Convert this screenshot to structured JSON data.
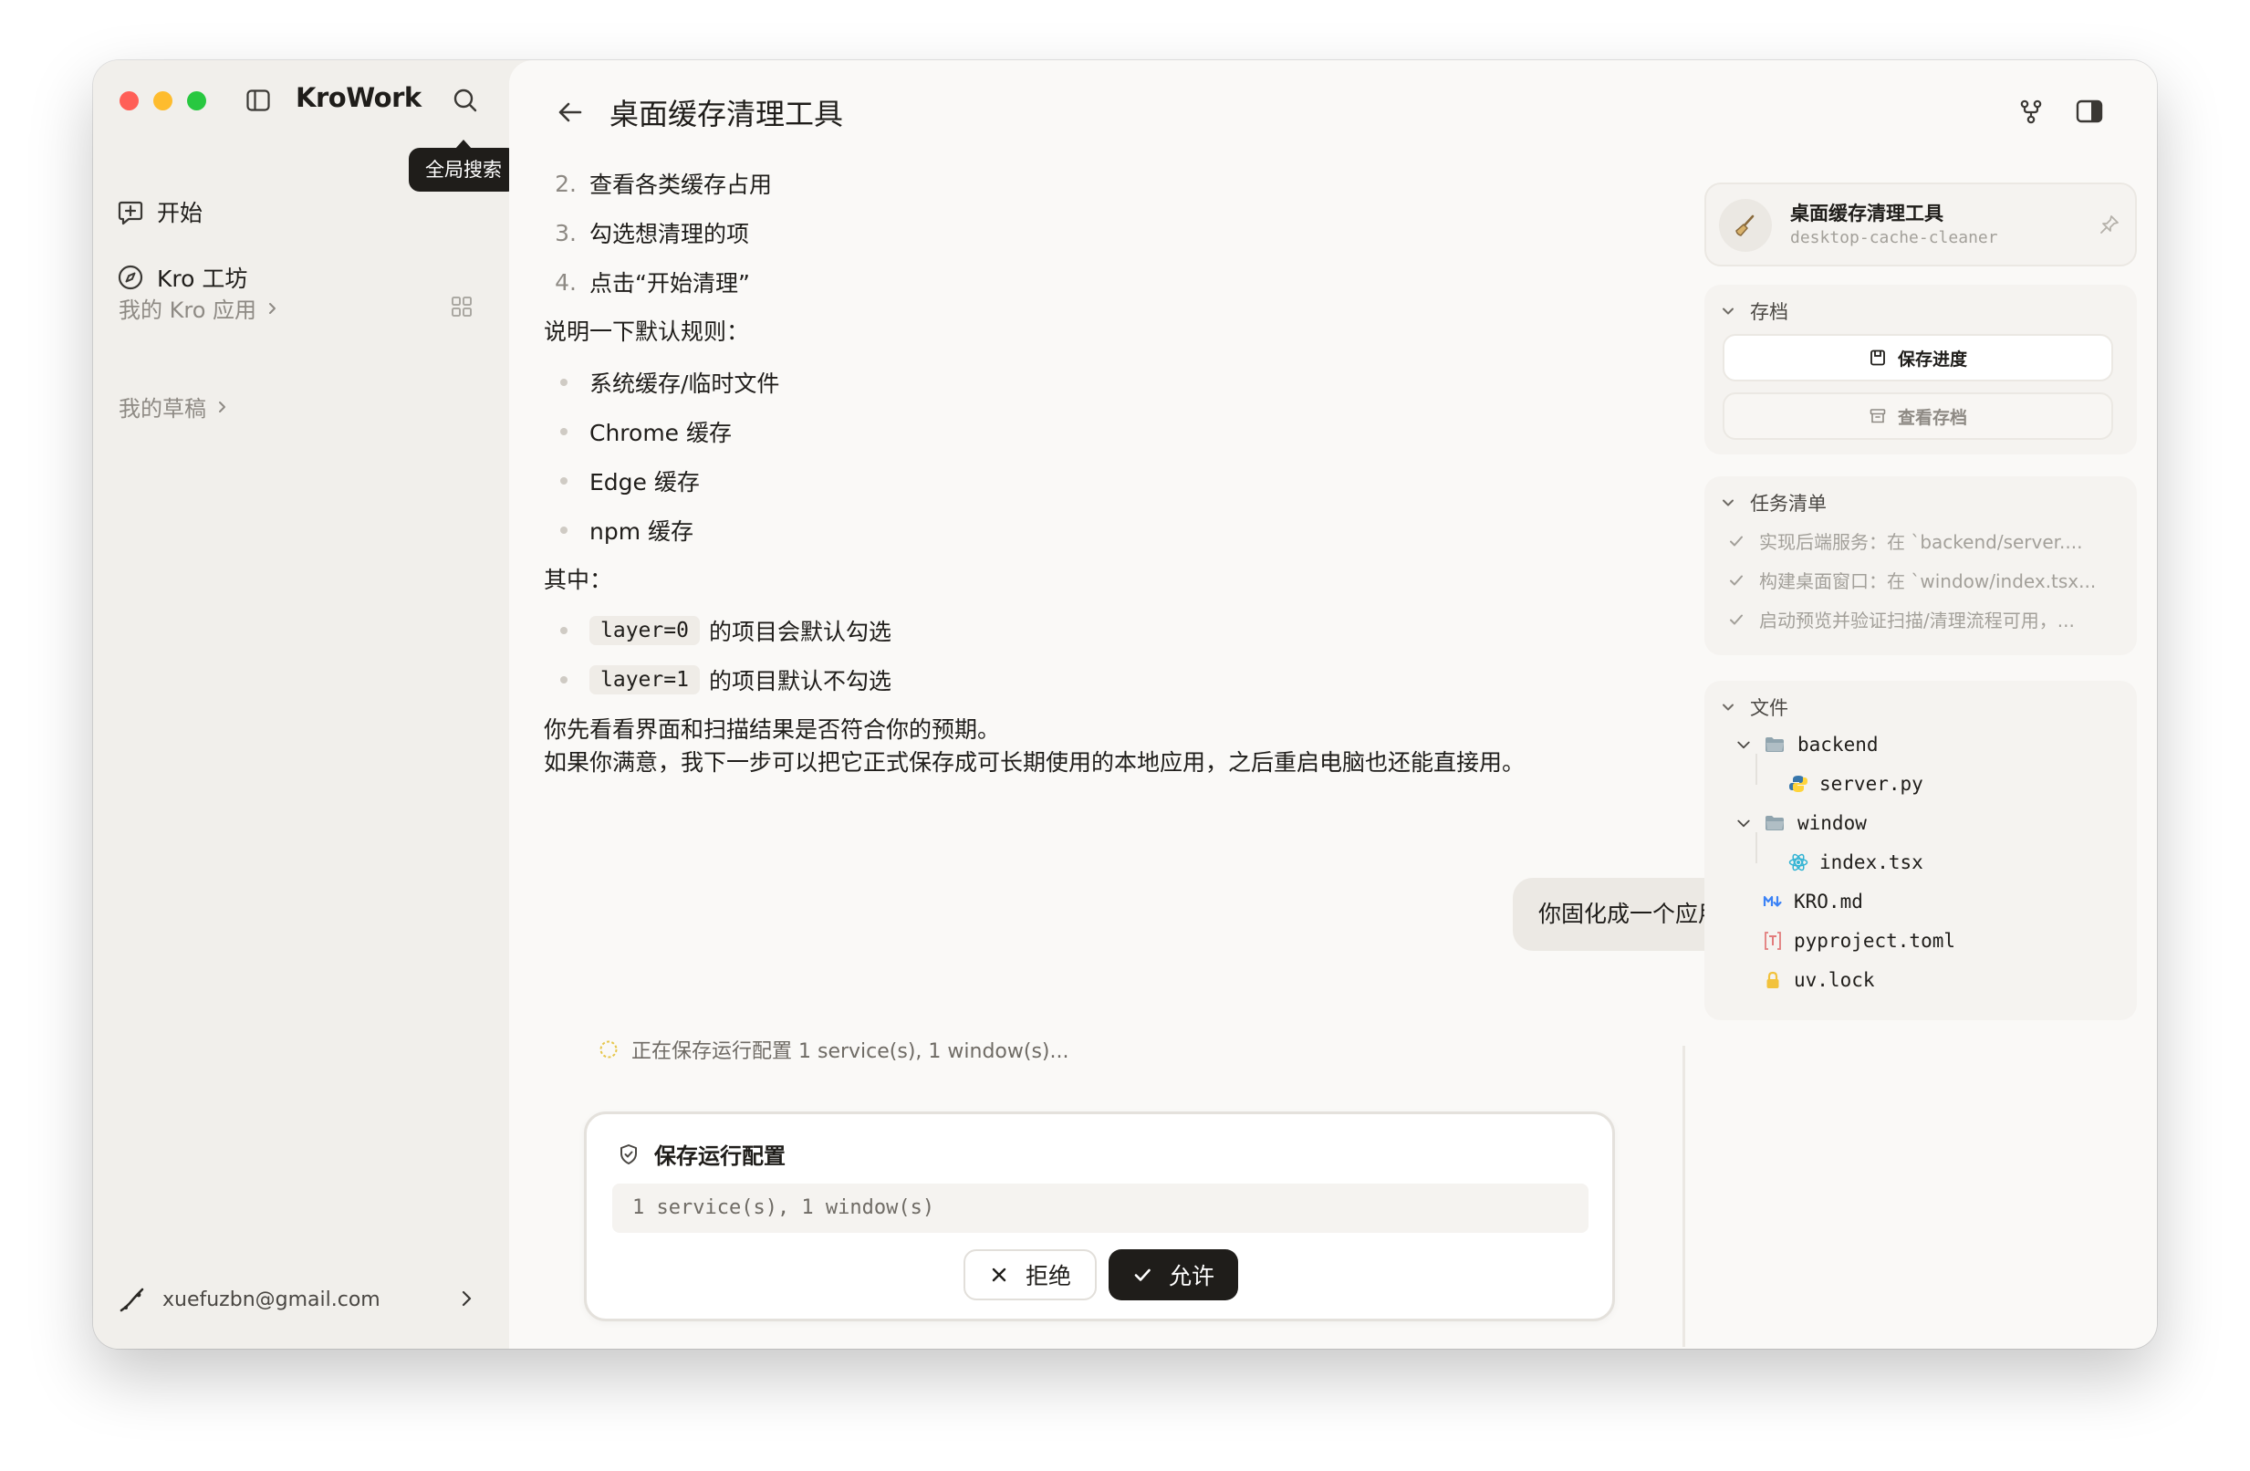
{
  "window": {
    "traffic_lights": [
      "close",
      "minimize",
      "zoom"
    ]
  },
  "sidebar": {
    "app_title": "KroWork",
    "search_tooltip": "全局搜索",
    "nav": [
      {
        "label": "开始",
        "icon": "new-chat-icon"
      },
      {
        "label": "Kro 工坊",
        "icon": "compass-icon"
      }
    ],
    "my_apps_label": "我的 Kro 应用",
    "drafts_label": "我的草稿",
    "account_email": "xuefuzbn@gmail.com"
  },
  "header": {
    "title": "桌面缓存清理工具",
    "icons": [
      "fork-icon",
      "panel-toggle-icon"
    ]
  },
  "chat": {
    "ordered_steps": [
      {
        "num": "2.",
        "text": "查看各类缓存占用"
      },
      {
        "num": "3.",
        "text": "勾选想清理的项"
      },
      {
        "num": "4.",
        "text": "点击“开始清理”"
      }
    ],
    "rules_intro": "说明一下默认规则：",
    "rules": [
      "系统缓存/临时文件",
      "Chrome 缓存",
      "Edge 缓存",
      "npm 缓存"
    ],
    "layers_intro": "其中：",
    "layers": [
      {
        "code": "layer=0",
        "text": "的项目会默认勾选"
      },
      {
        "code": "layer=1",
        "text": "的项目默认不勾选"
      }
    ],
    "closing_line1": "你先看看界面和扫描结果是否符合你的预期。",
    "closing_line2": "如果你满意，我下一步可以把它正式保存成可长期使用的本地应用，之后重启电脑也还能直接用。",
    "user_message": "你固化成一个应用",
    "status_text": "正在保存运行配置 1 service(s), 1 window(s)..."
  },
  "permission": {
    "title": "保存运行配置",
    "detail": "1 service(s), 1 window(s)",
    "reject_label": "拒绝",
    "allow_label": "允许"
  },
  "right_panel": {
    "project": {
      "name": "桌面缓存清理工具",
      "slug": "desktop-cache-cleaner"
    },
    "archive": {
      "title": "存档",
      "save_label": "保存进度",
      "view_label": "查看存档"
    },
    "tasks": {
      "title": "任务清单",
      "items": [
        "实现后端服务：在 `backend/server....",
        "构建桌面窗口：在 `window/index.tsx...",
        "启动预览并验证扫描/清理流程可用，..."
      ]
    },
    "files": {
      "title": "文件",
      "tree": [
        {
          "name": "backend",
          "type": "folder"
        },
        {
          "name": "server.py",
          "type": "python"
        },
        {
          "name": "window",
          "type": "folder"
        },
        {
          "name": "index.tsx",
          "type": "react"
        },
        {
          "name": "KRO.md",
          "type": "markdown"
        },
        {
          "name": "pyproject.toml",
          "type": "toml"
        },
        {
          "name": "uv.lock",
          "type": "lock"
        }
      ]
    }
  },
  "colors": {
    "sidebar_bg": "#f1efeb",
    "main_bg": "#faf9f7",
    "accent_dark": "#1f1d1a",
    "muted_text": "#8e8a84",
    "traffic_red": "#ff5f57",
    "traffic_yellow": "#febc2e",
    "traffic_green": "#28c840",
    "status_spinner": "#e6c64a"
  }
}
